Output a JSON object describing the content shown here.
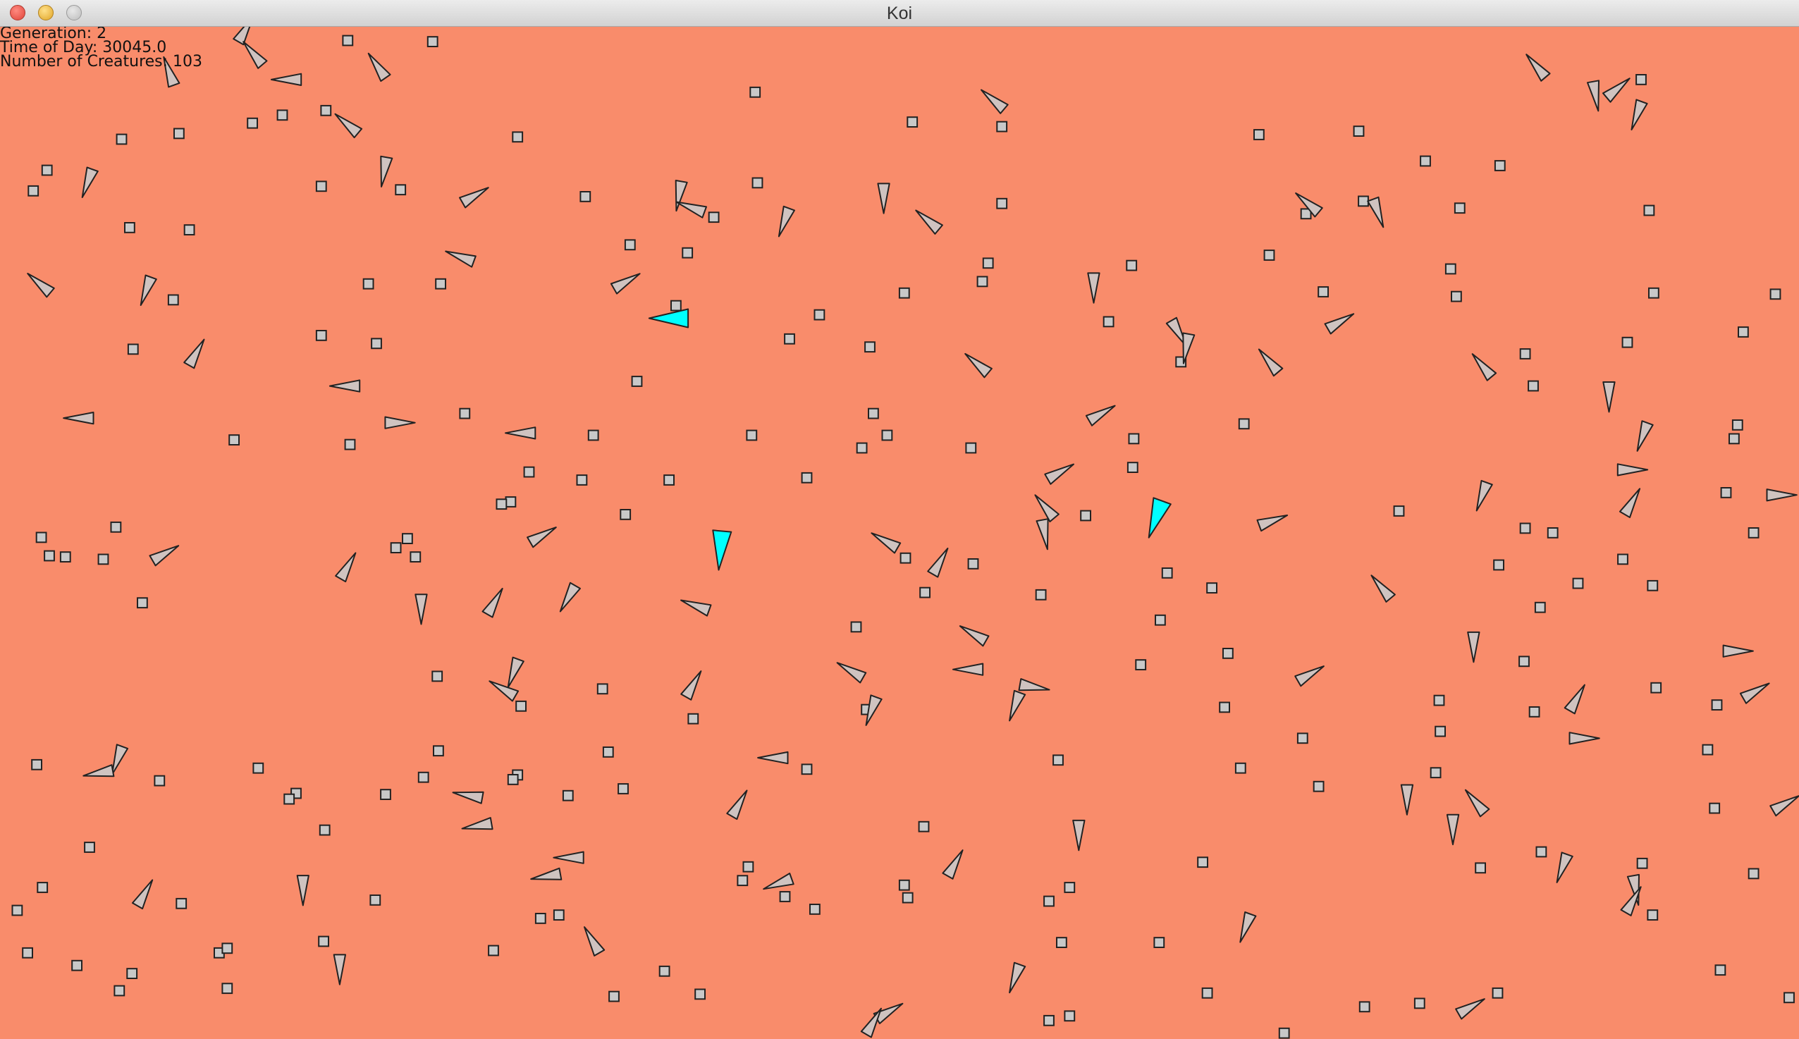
{
  "window": {
    "title": "Koi"
  },
  "hud": {
    "generation": "Generation: 2",
    "time_of_day": "Time of Day: 30045.0",
    "creature_count": "Number of Creatures: 103"
  },
  "colors": {
    "background": "#f98c6b",
    "food": "#c8c8c8",
    "creature": "#cfc3c0",
    "highlighted_creature": "#00ffff",
    "outline": "#222222"
  }
}
